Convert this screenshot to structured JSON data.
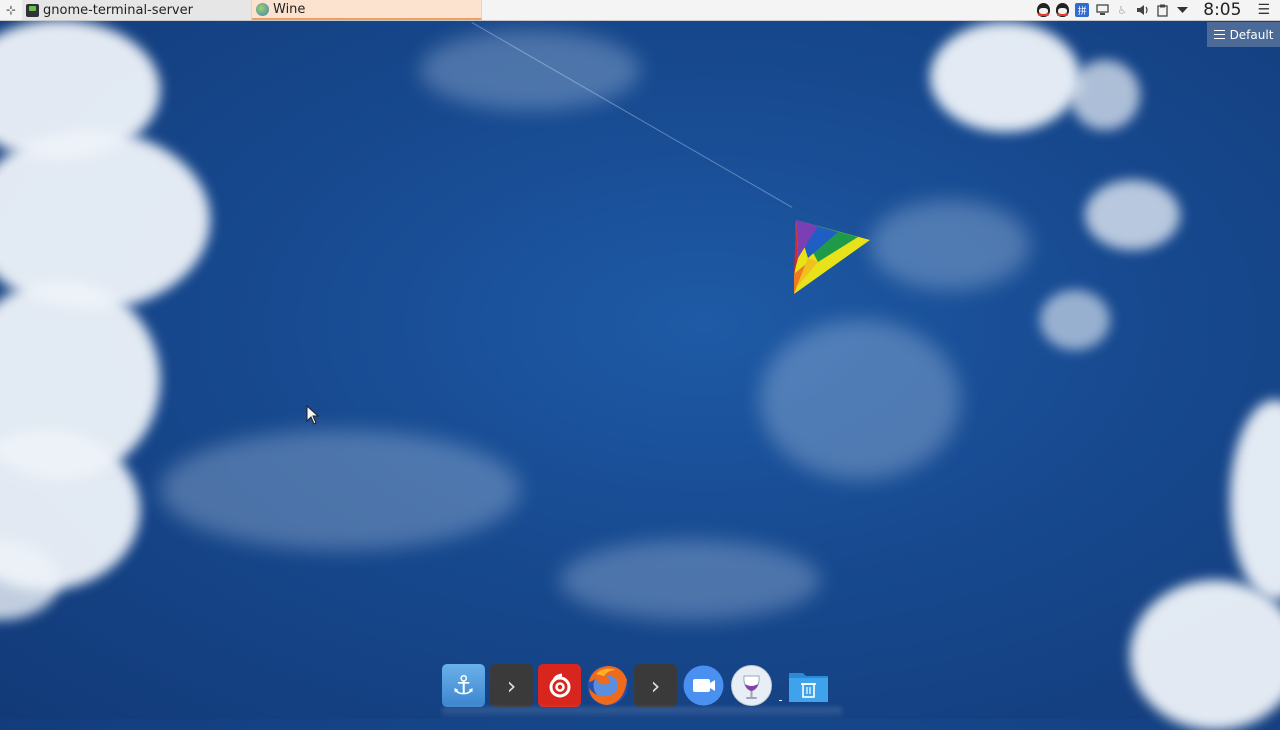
{
  "panel": {
    "launcher_icon": "app-launcher-icon",
    "tasks": [
      {
        "label": "gnome-terminal-server",
        "icon": "terminal-app-icon"
      },
      {
        "label": "Wine",
        "icon": "wine-app-icon",
        "active": true
      }
    ],
    "tray": {
      "icons": [
        "qq-icon",
        "qq-icon-2",
        "input-method-icon",
        "display-icon",
        "accessibility-icon",
        "volume-icon",
        "clipboard-icon",
        "dropdown-icon"
      ],
      "input_method_label": "拼",
      "clock": "8:05"
    },
    "menu_icon": "hamburger-menu-icon"
  },
  "workspace": {
    "label": "Default"
  },
  "dock": {
    "items": [
      {
        "name": "anchor-app",
        "icon": "anchor-icon",
        "glyph": "⚓"
      },
      {
        "name": "terminal",
        "icon": "terminal-icon",
        "glyph": "›"
      },
      {
        "name": "netease-music",
        "icon": "netease-music-icon"
      },
      {
        "name": "firefox",
        "icon": "firefox-icon"
      },
      {
        "name": "terminal-2",
        "icon": "terminal-icon",
        "glyph": "›"
      },
      {
        "name": "chat",
        "icon": "chat-icon"
      },
      {
        "name": "wine",
        "icon": "wine-icon"
      },
      {
        "name": "files",
        "icon": "folder-trash-icon"
      }
    ]
  },
  "colors": {
    "sky": "#17498f",
    "panel_bg": "#f4f4f4",
    "active_task_bg": "#fbe3cf",
    "active_task_accent": "#f0a060"
  }
}
